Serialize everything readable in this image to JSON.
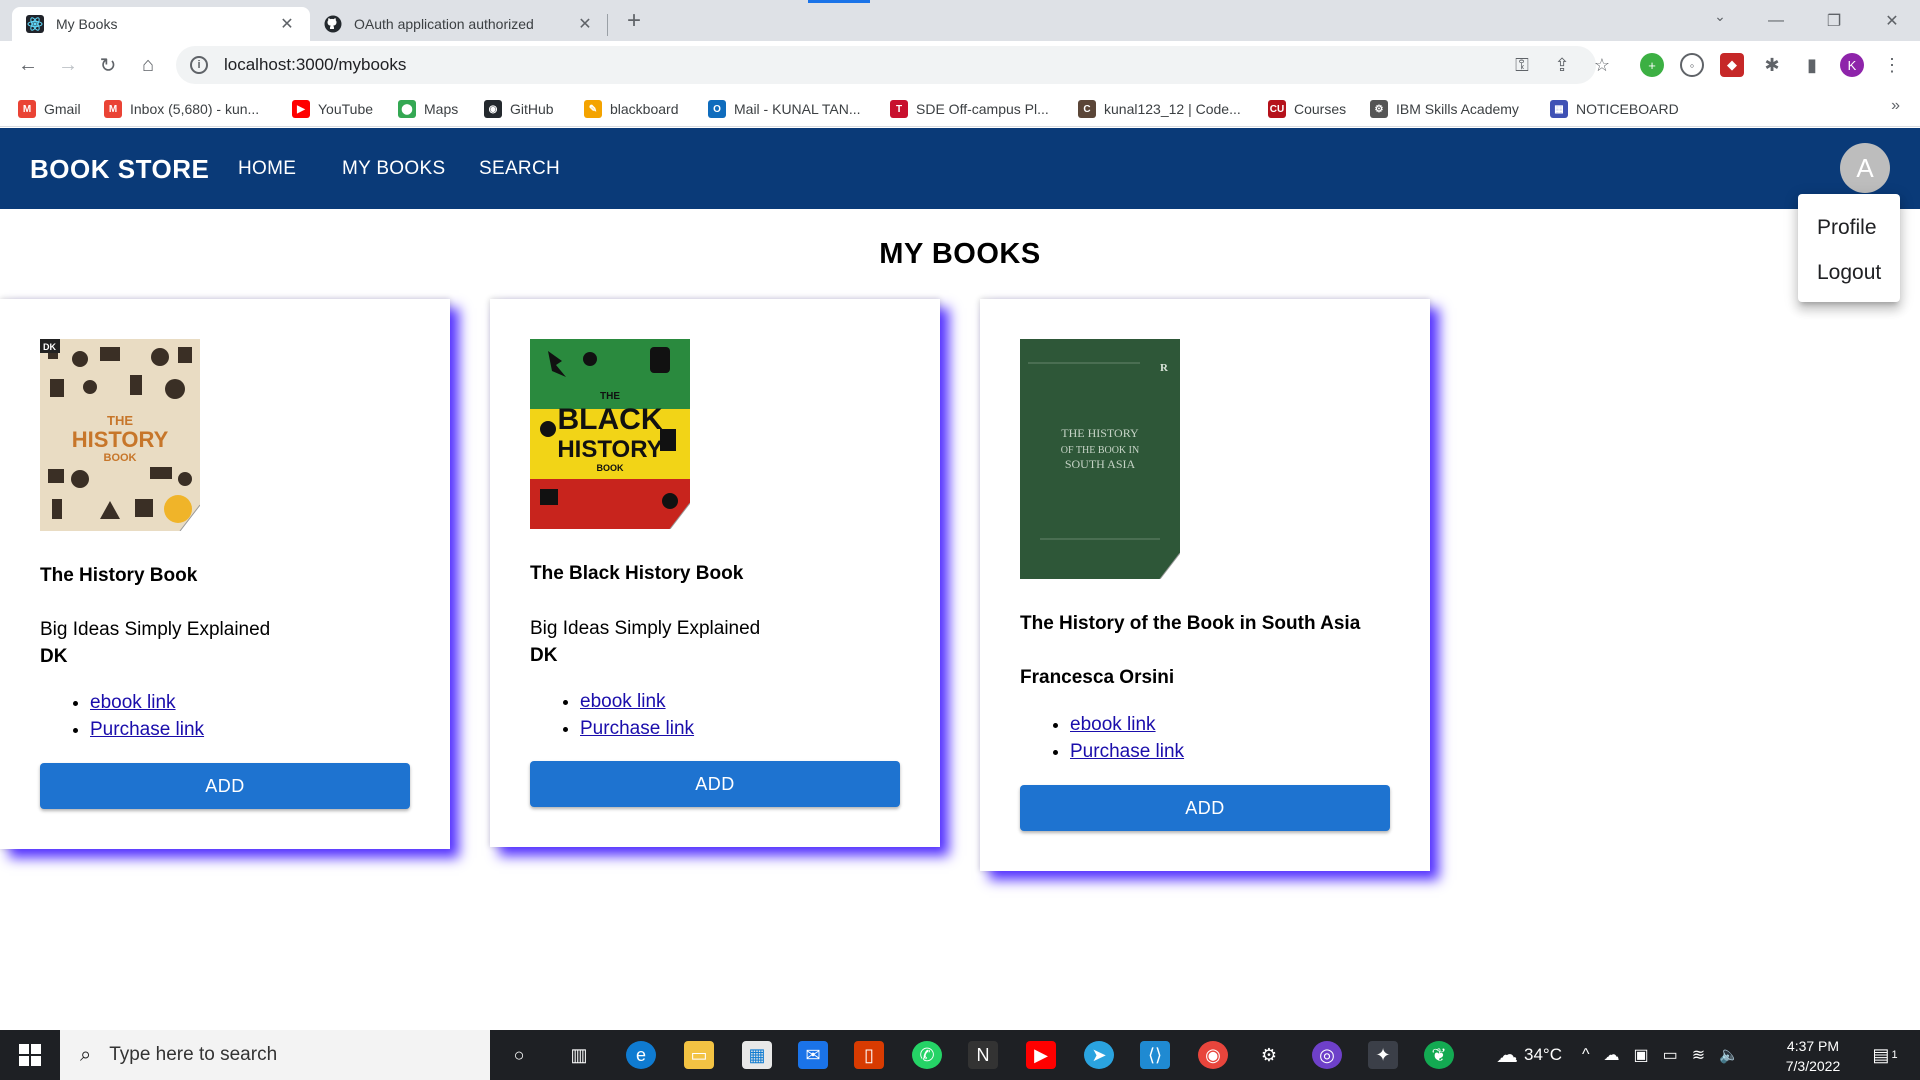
{
  "browser": {
    "tabs": [
      {
        "title": "My Books",
        "active": true
      },
      {
        "title": "OAuth application authorized",
        "active": false
      }
    ],
    "url": "localhost:3000/mybooks",
    "profile_initial": "K",
    "bookmarks": [
      {
        "label": "Gmail",
        "icon": "gmail-icon",
        "color": "#ea4335"
      },
      {
        "label": "Inbox (5,680) - kun...",
        "icon": "gmail-icon",
        "color": "#ea4335"
      },
      {
        "label": "YouTube",
        "icon": "youtube-icon",
        "color": "#ff0000"
      },
      {
        "label": "Maps",
        "icon": "maps-icon",
        "color": "#34a853"
      },
      {
        "label": "GitHub",
        "icon": "github-icon",
        "color": "#24292e"
      },
      {
        "label": "blackboard",
        "icon": "blackboard-icon",
        "color": "#f4a300"
      },
      {
        "label": "Mail - KUNAL TAN...",
        "icon": "outlook-icon",
        "color": "#0f6cbd"
      },
      {
        "label": "SDE Off-campus Pl...",
        "icon": "tuf-icon",
        "color": "#c8102e"
      },
      {
        "label": "kunal123_12 | Code...",
        "icon": "codechef-icon",
        "color": "#5b4638"
      },
      {
        "label": "Courses",
        "icon": "cu-icon",
        "color": "#b5121b"
      },
      {
        "label": "IBM Skills Academy",
        "icon": "ibm-icon",
        "color": "#555555"
      },
      {
        "label": "NOTICEBOARD",
        "icon": "noticeboard-icon",
        "color": "#3f51b5"
      }
    ]
  },
  "app": {
    "brand": "BOOK STORE",
    "nav": [
      "HOME",
      "MY BOOKS",
      "SEARCH"
    ],
    "avatar_initial": "A",
    "menu": [
      "Profile",
      "Logout"
    ],
    "page_title": "MY BOOKS",
    "books": [
      {
        "title": "The History Book",
        "subtitle": "Big Ideas Simply Explained",
        "author": "DK",
        "links": [
          "ebook link",
          "Purchase link"
        ],
        "button": "ADD",
        "cover_text": [
          "THE",
          "HISTORY",
          "BOOK"
        ]
      },
      {
        "title": "The Black History Book",
        "subtitle": "Big Ideas Simply Explained",
        "author": "DK",
        "links": [
          "ebook link",
          "Purchase link"
        ],
        "button": "ADD",
        "cover_text": [
          "THE",
          "BLACK",
          "HISTORY",
          "BOOK"
        ]
      },
      {
        "title": "The History of the Book in South Asia",
        "author": "Francesca Orsini",
        "links": [
          "ebook link",
          "Purchase link"
        ],
        "button": "ADD",
        "cover_text": [
          "THE HISTORY",
          "OF THE BOOK IN",
          "SOUTH ASIA"
        ]
      }
    ]
  },
  "taskbar": {
    "search_placeholder": "Type here to search",
    "temperature": "34°C",
    "time": "4:37 PM",
    "date": "7/3/2022",
    "notifications": "1"
  },
  "colors": {
    "appbar": "#0a3a78",
    "button": "#1e73d0",
    "card_shadow": "#5533ff"
  }
}
